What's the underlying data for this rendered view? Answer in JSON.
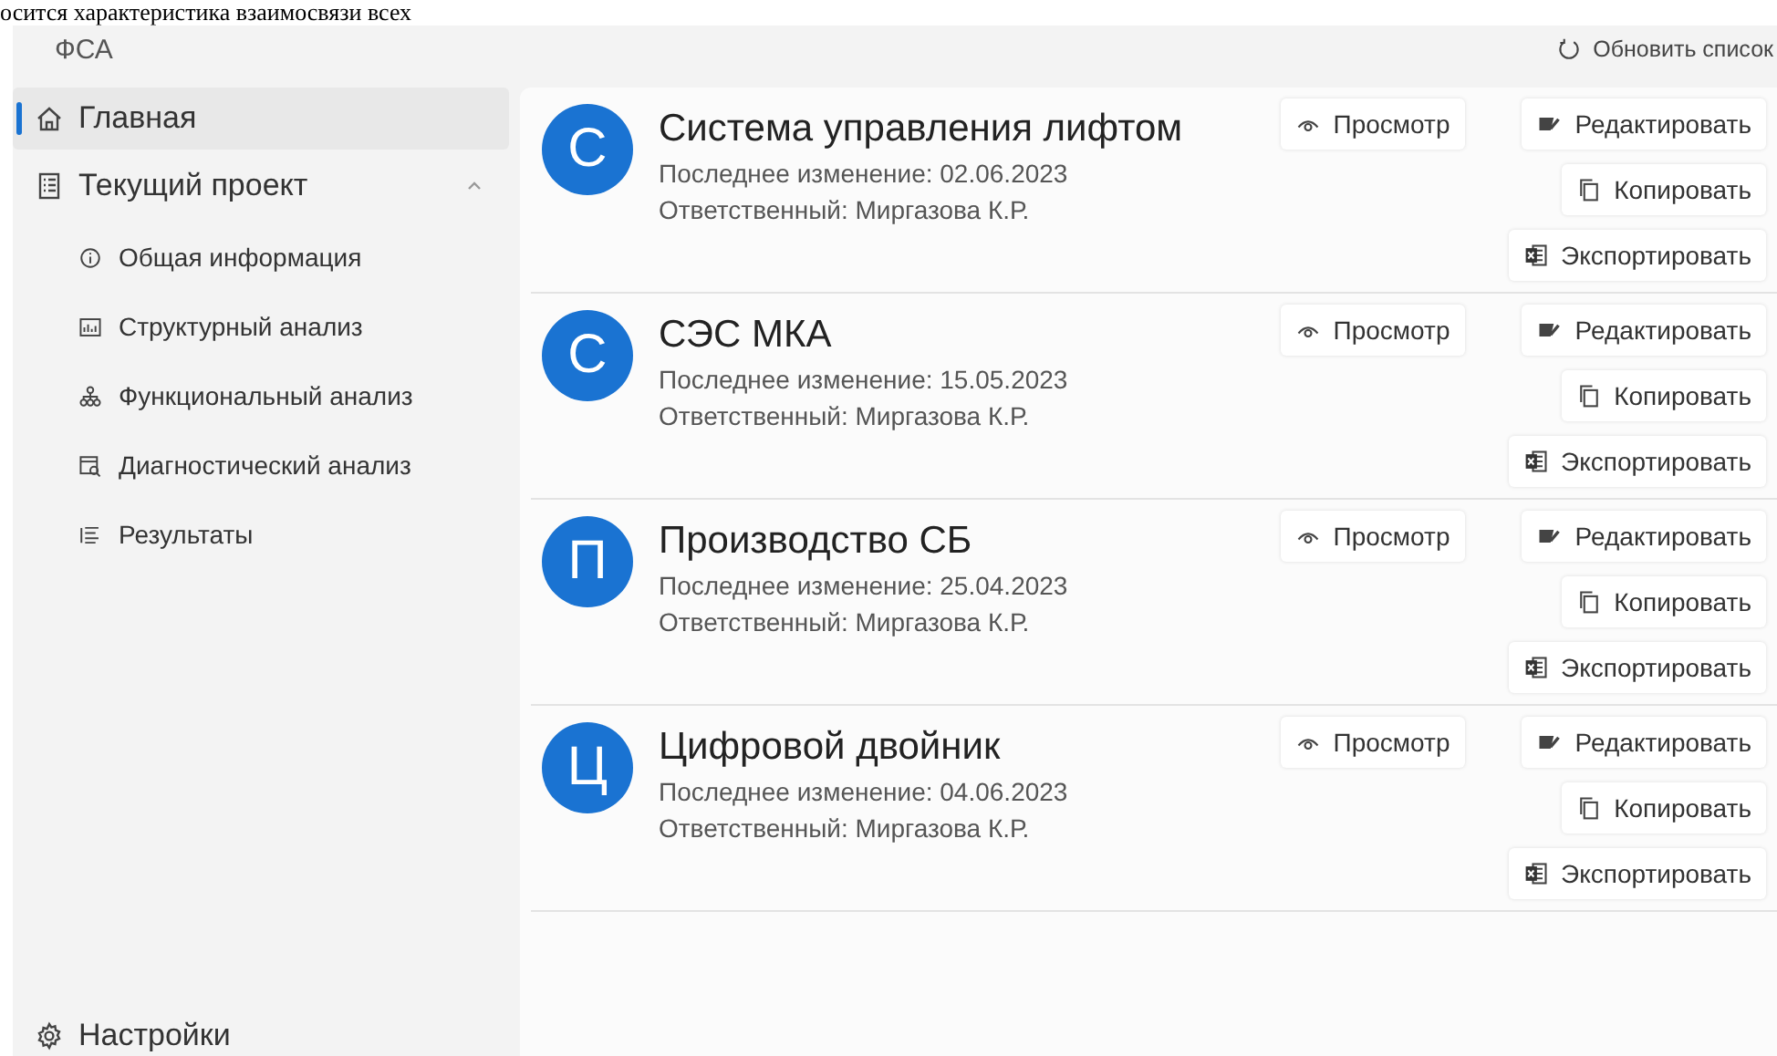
{
  "document_text": "осится характеристика взаимосвязи всех",
  "app": {
    "title": "ФСА",
    "refresh_button": "Обновить список"
  },
  "sidebar": {
    "items": [
      {
        "label": "Главная",
        "selected": true
      },
      {
        "label": "Текущий проект",
        "selected": false,
        "expanded": true,
        "children": [
          {
            "label": "Общая информация",
            "selected": false
          },
          {
            "label": "Структурный анализ",
            "selected": false
          },
          {
            "label": "Функциональный анализ",
            "selected": false
          },
          {
            "label": "Диагностический анализ",
            "selected": false
          },
          {
            "label": "Результаты",
            "selected": false
          }
        ]
      }
    ],
    "settings": "Настройки"
  },
  "projects": [
    {
      "initial": "С",
      "name": "Система управления лифтом",
      "modified": "Последнее изменение: 02.06.2023",
      "responsible": "Ответственный: Миргазова К.Р.",
      "actions": [
        "Просмотр",
        "Редактировать",
        "Копировать",
        "Экспортировать"
      ]
    },
    {
      "initial": "С",
      "name": "СЭС МКА",
      "modified": "Последнее изменение: 15.05.2023",
      "responsible": "Ответственный: Миргазова К.Р.",
      "actions": [
        "Просмотр",
        "Редактировать",
        "Копировать",
        "Экспортировать"
      ]
    },
    {
      "initial": "П",
      "name": "Производство СБ",
      "modified": "Последнее изменение: 25.04.2023",
      "responsible": "Ответственный: Миргазова К.Р.",
      "actions": [
        "Просмотр",
        "Редактировать",
        "Копировать",
        "Экспортировать"
      ]
    },
    {
      "initial": "Ц",
      "name": "Цифровой двойник",
      "modified": "Последнее изменение: 04.06.2023",
      "responsible": "Ответственный: Миргазова К.Р.",
      "actions": [
        "Просмотр",
        "Редактировать",
        "Копировать",
        "Экспортировать"
      ]
    }
  ]
}
